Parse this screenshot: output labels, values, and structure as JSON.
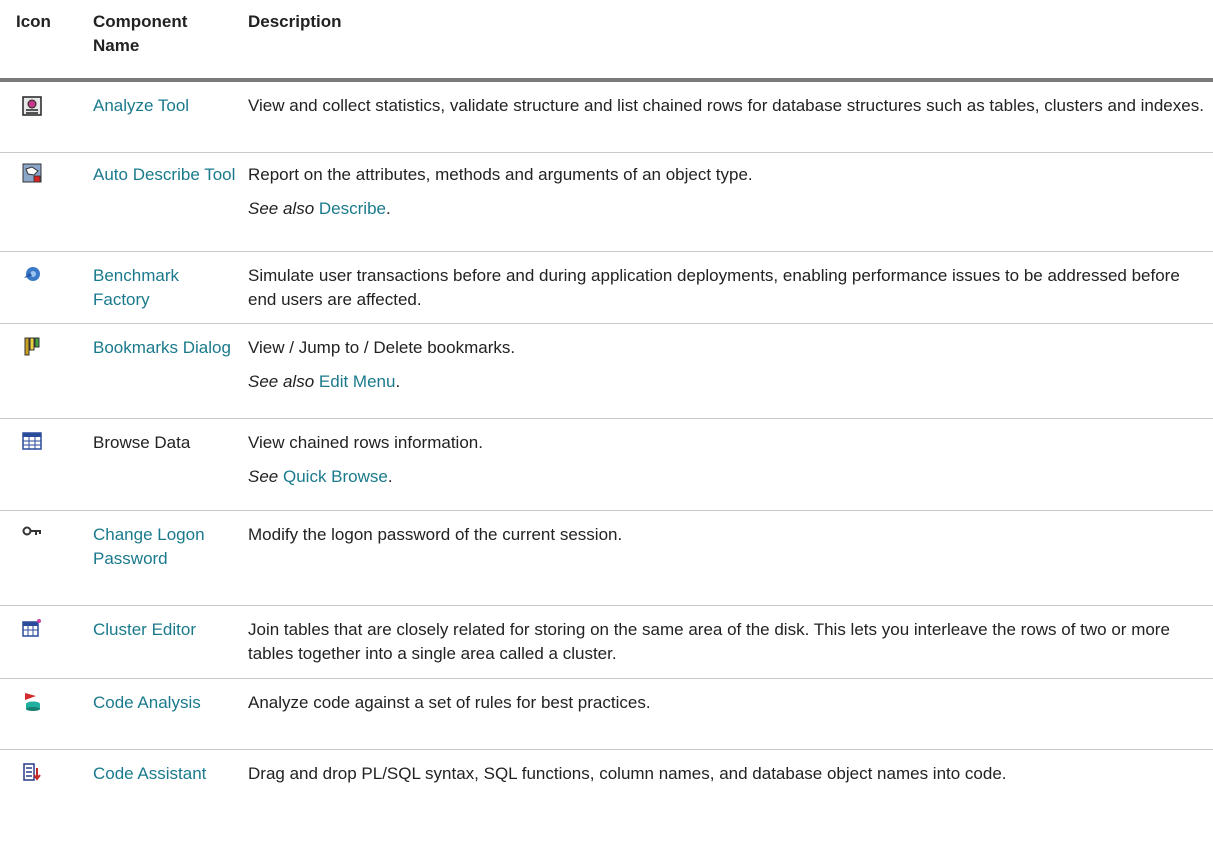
{
  "header": {
    "icon": "Icon",
    "component": "Component Name",
    "description": "Description"
  },
  "rows": [
    {
      "icon": "analyze-tool-icon",
      "name": "Analyze Tool",
      "name_is_link": true,
      "description": "View and collect statistics, validate structure and list chained rows for database structures such as tables, clusters and indexes."
    },
    {
      "icon": "auto-describe-icon",
      "name": "Auto Describe Tool",
      "name_is_link": true,
      "description": "Report on the attributes, methods and arguments of an object type.",
      "see": {
        "prefix": "See also",
        "link": "Describe",
        "suffix": "."
      }
    },
    {
      "icon": "benchmark-factory-icon",
      "name": "Benchmark Factory",
      "name_is_link": true,
      "description": "Simulate user transactions before and during application deployments, enabling performance issues to be addressed before end users are affected."
    },
    {
      "icon": "bookmarks-icon",
      "name": "Bookmarks Dialog",
      "name_is_link": true,
      "description": "View / Jump to / Delete bookmarks.",
      "see": {
        "prefix": "See also",
        "link": "Edit Menu",
        "suffix": "."
      }
    },
    {
      "icon": "browse-data-grid-icon",
      "name": "Browse Data",
      "name_is_link": false,
      "description": "View chained rows information.",
      "see": {
        "prefix": "See",
        "link": "Quick Browse",
        "suffix": "."
      }
    },
    {
      "icon": "key-icon",
      "name": "Change Logon Password",
      "name_is_link": true,
      "description": "Modify the logon password of the current session."
    },
    {
      "icon": "cluster-editor-icon",
      "name": "Cluster Editor",
      "name_is_link": true,
      "description": "Join tables that are closely related for storing on the same area of the disk. This lets you interleave the rows of two or more tables together into a single area called a cluster."
    },
    {
      "icon": "code-analysis-icon",
      "name": "Code Analysis",
      "name_is_link": true,
      "description": "Analyze code against a set of rules for best practices."
    },
    {
      "icon": "code-assistant-icon",
      "name": "Code Assistant",
      "name_is_link": true,
      "description": "Drag and drop PL/SQL syntax, SQL functions, column names, and database object names into code."
    }
  ]
}
